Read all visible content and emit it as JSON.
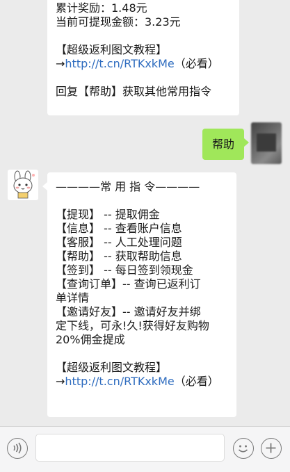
{
  "previous_message": {
    "lines": [
      "累计奖励：1.48元",
      "当前可提现金额：3.23元",
      "",
      "【超级返利图文教程】",
      "→",
      "http://t.cn/RTKxkMe",
      "（必看）",
      "",
      "回复【帮助】获取其他常用指令"
    ]
  },
  "user_message": {
    "text": "帮助"
  },
  "bot_reply": {
    "header": "————常 用 指 令————",
    "commands": [
      {
        "key": "【提现】",
        "sep": " -- ",
        "desc": "提取佣金"
      },
      {
        "key": "【信息】",
        "sep": " -- ",
        "desc": "查看账户信息"
      },
      {
        "key": "【客服】",
        "sep": " -- ",
        "desc": "人工处理问题"
      },
      {
        "key": "【帮助】",
        "sep": " -- ",
        "desc": "获取帮助信息"
      },
      {
        "key": "【签到】",
        "sep": " -- ",
        "desc": "每日签到领现金"
      }
    ],
    "query_line1": "【查询订单】-- 查询已返利订",
    "query_line2": "单详情",
    "invite_line1": "【邀请好友】-- 邀请好友并绑",
    "invite_line2": "定下线，可永!久!获得好友购物",
    "invite_line3": "20%佣金提成",
    "tutorial_title": "【超级返利图文教程】",
    "tutorial_arrow": "→",
    "tutorial_link": "http://t.cn/RTKxkMe",
    "tutorial_note": "（必看）"
  },
  "colors": {
    "chat_background": "#ebebeb",
    "user_bubble": "#a0e75a",
    "bot_bubble": "#ffffff",
    "link": "#2e6cbf"
  },
  "icons": {
    "voice": "voice-icon",
    "emoji": "emoji-icon",
    "plus": "plus-icon"
  }
}
